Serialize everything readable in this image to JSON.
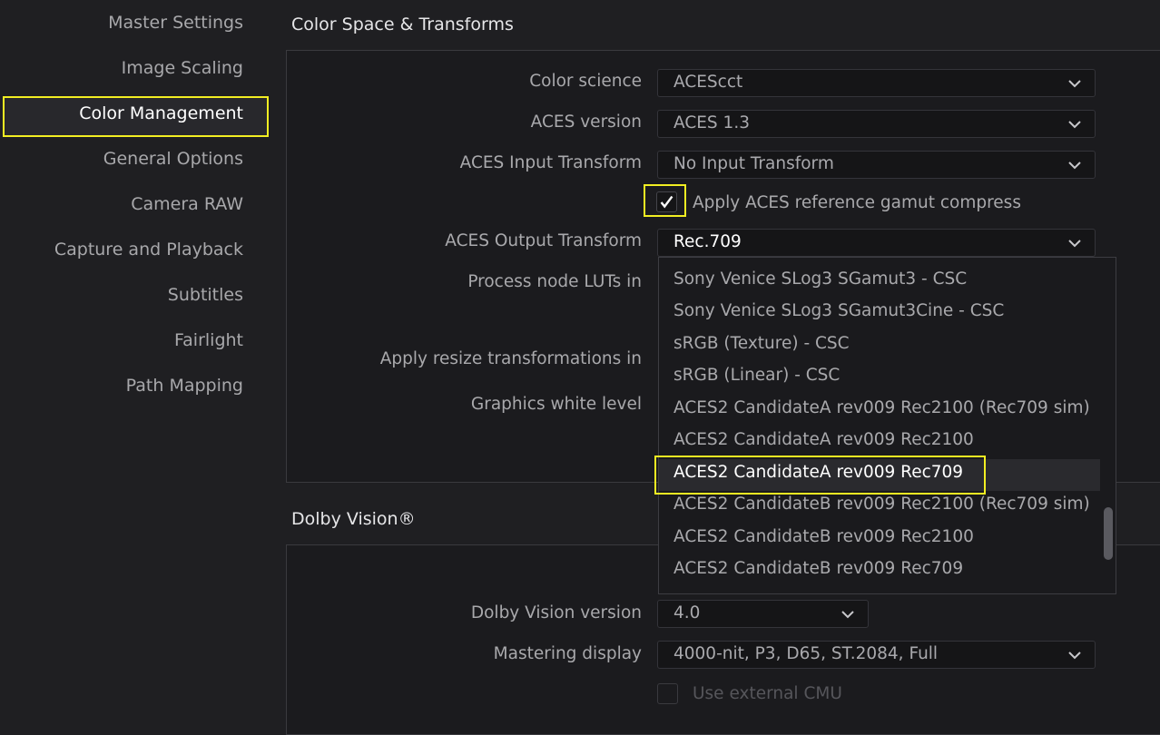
{
  "sidebar": {
    "items": [
      {
        "label": "Master Settings"
      },
      {
        "label": "Image Scaling"
      },
      {
        "label": "Color Management"
      },
      {
        "label": "General Options"
      },
      {
        "label": "Camera RAW"
      },
      {
        "label": "Capture and Playback"
      },
      {
        "label": "Subtitles"
      },
      {
        "label": "Fairlight"
      },
      {
        "label": "Path Mapping"
      }
    ],
    "active": "Color Management"
  },
  "color_space": {
    "title": "Color Space & Transforms",
    "color_science": {
      "label": "Color science",
      "value": "ACEScct"
    },
    "aces_version": {
      "label": "ACES version",
      "value": "ACES 1.3"
    },
    "aces_input": {
      "label": "ACES Input Transform",
      "value": "No Input Transform"
    },
    "gamut_compress": {
      "label": "Apply ACES reference gamut compress",
      "checked": true
    },
    "aces_output": {
      "label": "ACES Output Transform",
      "value": "Rec.709"
    },
    "process_luts_label": "Process node LUTs in",
    "resize_label": "Apply resize transformations in",
    "graphics_white_label": "Graphics white level"
  },
  "output_list": {
    "items": [
      "Sony Venice SLog3 SGamut3 - CSC",
      "Sony Venice SLog3 SGamut3Cine - CSC",
      "sRGB (Texture) - CSC",
      "sRGB (Linear) - CSC",
      "ACES2 CandidateA rev009 Rec2100 (Rec709 sim)",
      "ACES2 CandidateA rev009 Rec2100",
      "ACES2 CandidateA rev009 Rec709",
      "ACES2 CandidateB rev009 Rec2100 (Rec709 sim)",
      "ACES2 CandidateB rev009 Rec2100",
      "ACES2 CandidateB rev009 Rec709"
    ],
    "highlighted": "ACES2 CandidateA rev009 Rec709"
  },
  "dolby": {
    "title": "Dolby Vision®",
    "version": {
      "label": "Dolby Vision version",
      "value": "4.0"
    },
    "mastering": {
      "label": "Mastering display",
      "value": "4000-nit, P3, D65, ST.2084, Full"
    },
    "external_cmu": {
      "label": "Use external CMU",
      "checked": false
    }
  },
  "colors": {
    "accent_outline": "#f2ee22",
    "background": "#1f1f22"
  }
}
